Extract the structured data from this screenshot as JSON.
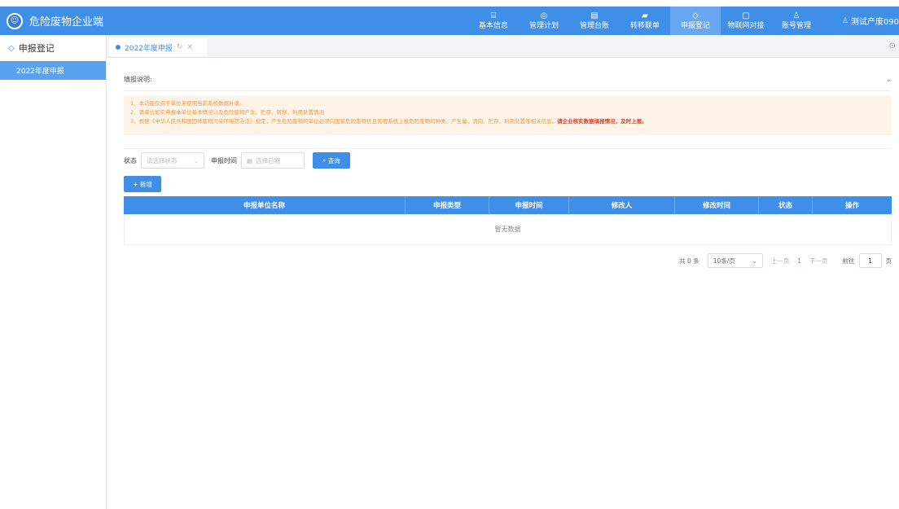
{
  "header": {
    "app_title": "危险废物企业端",
    "logo_icon": "emblem-icon",
    "nav": [
      {
        "label": "基本信息",
        "icon": "form-icon",
        "glyph": "⌸"
      },
      {
        "label": "管理计划",
        "icon": "target-icon",
        "glyph": "◎"
      },
      {
        "label": "管理台账",
        "icon": "ledger-icon",
        "glyph": "▤"
      },
      {
        "label": "转移联单",
        "icon": "truck-icon",
        "glyph": "▰"
      },
      {
        "label": "申报登记",
        "icon": "shield-icon",
        "glyph": "◇"
      },
      {
        "label": "物联网对接",
        "icon": "chat-icon",
        "glyph": "▢"
      },
      {
        "label": "账号管理",
        "icon": "user-icon",
        "glyph": "♙"
      }
    ],
    "active_nav": "申报登记",
    "user_name": "测试产废090"
  },
  "sidebar": {
    "section_title": "申报登记",
    "items": [
      {
        "label": "2022年度申报"
      }
    ]
  },
  "tabs": {
    "items": [
      {
        "label": "2022年度申报"
      }
    ]
  },
  "notice": {
    "title": "填报说明:",
    "line1": "1、本功能仅用于单位未使用当前系统数据补录。",
    "line2": "2、请单位如实申报本单位基本情况以及危险废物产生、贮存、转移、利用处置情况",
    "line3": "3、根据《中华人民共和国固体废物污染环境防治法》规定，产生危险废物的单位必须向国家危险废物信息管理系统上报危险废物的种类、产生量、流向、贮存、利用处置等相关信息。",
    "line3_emphasis": "请企业核实数据填报情况，及时上报。"
  },
  "filters": {
    "status_label": "状态",
    "status_placeholder": "请选择状态",
    "time_label": "申报时间",
    "date_placeholder": "选择日期",
    "query_button": "查询",
    "add_button": "+ 新增"
  },
  "table": {
    "columns": [
      "申报单位名称",
      "申报类型",
      "申报时间",
      "修改人",
      "修改时间",
      "状态",
      "操作"
    ],
    "empty_text": "暂无数据"
  },
  "pagination": {
    "total": "共 0 条",
    "page_size": "10条/页",
    "prev": "上一页",
    "current": "1",
    "next": "下一页",
    "goto_label": "前往",
    "goto_value": "1",
    "page_unit": "页"
  },
  "colors": {
    "primary": "#3f8ee8",
    "notice_bg": "#fdf3e6",
    "notice_text": "#e6994a",
    "emphasis": "#e23b2c"
  }
}
